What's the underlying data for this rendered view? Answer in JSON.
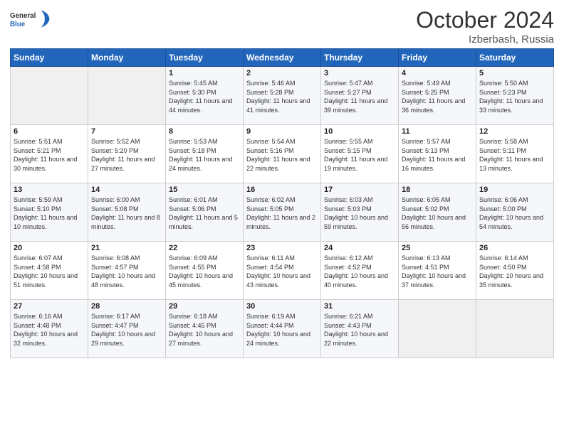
{
  "header": {
    "logo_general": "General",
    "logo_blue": "Blue",
    "title": "October 2024",
    "location": "Izberbash, Russia"
  },
  "weekdays": [
    "Sunday",
    "Monday",
    "Tuesday",
    "Wednesday",
    "Thursday",
    "Friday",
    "Saturday"
  ],
  "weeks": [
    [
      {
        "day": "",
        "empty": true
      },
      {
        "day": "",
        "empty": true
      },
      {
        "day": "1",
        "sunrise": "5:45 AM",
        "sunset": "5:30 PM",
        "daylight": "11 hours and 44 minutes."
      },
      {
        "day": "2",
        "sunrise": "5:46 AM",
        "sunset": "5:28 PM",
        "daylight": "11 hours and 41 minutes."
      },
      {
        "day": "3",
        "sunrise": "5:47 AM",
        "sunset": "5:27 PM",
        "daylight": "11 hours and 39 minutes."
      },
      {
        "day": "4",
        "sunrise": "5:49 AM",
        "sunset": "5:25 PM",
        "daylight": "11 hours and 36 minutes."
      },
      {
        "day": "5",
        "sunrise": "5:50 AM",
        "sunset": "5:23 PM",
        "daylight": "11 hours and 33 minutes."
      }
    ],
    [
      {
        "day": "6",
        "sunrise": "5:51 AM",
        "sunset": "5:21 PM",
        "daylight": "11 hours and 30 minutes."
      },
      {
        "day": "7",
        "sunrise": "5:52 AM",
        "sunset": "5:20 PM",
        "daylight": "11 hours and 27 minutes."
      },
      {
        "day": "8",
        "sunrise": "5:53 AM",
        "sunset": "5:18 PM",
        "daylight": "11 hours and 24 minutes."
      },
      {
        "day": "9",
        "sunrise": "5:54 AM",
        "sunset": "5:16 PM",
        "daylight": "11 hours and 22 minutes."
      },
      {
        "day": "10",
        "sunrise": "5:55 AM",
        "sunset": "5:15 PM",
        "daylight": "11 hours and 19 minutes."
      },
      {
        "day": "11",
        "sunrise": "5:57 AM",
        "sunset": "5:13 PM",
        "daylight": "11 hours and 16 minutes."
      },
      {
        "day": "12",
        "sunrise": "5:58 AM",
        "sunset": "5:11 PM",
        "daylight": "11 hours and 13 minutes."
      }
    ],
    [
      {
        "day": "13",
        "sunrise": "5:59 AM",
        "sunset": "5:10 PM",
        "daylight": "11 hours and 10 minutes."
      },
      {
        "day": "14",
        "sunrise": "6:00 AM",
        "sunset": "5:08 PM",
        "daylight": "11 hours and 8 minutes."
      },
      {
        "day": "15",
        "sunrise": "6:01 AM",
        "sunset": "5:06 PM",
        "daylight": "11 hours and 5 minutes."
      },
      {
        "day": "16",
        "sunrise": "6:02 AM",
        "sunset": "5:05 PM",
        "daylight": "11 hours and 2 minutes."
      },
      {
        "day": "17",
        "sunrise": "6:03 AM",
        "sunset": "5:03 PM",
        "daylight": "10 hours and 59 minutes."
      },
      {
        "day": "18",
        "sunrise": "6:05 AM",
        "sunset": "5:02 PM",
        "daylight": "10 hours and 56 minutes."
      },
      {
        "day": "19",
        "sunrise": "6:06 AM",
        "sunset": "5:00 PM",
        "daylight": "10 hours and 54 minutes."
      }
    ],
    [
      {
        "day": "20",
        "sunrise": "6:07 AM",
        "sunset": "4:58 PM",
        "daylight": "10 hours and 51 minutes."
      },
      {
        "day": "21",
        "sunrise": "6:08 AM",
        "sunset": "4:57 PM",
        "daylight": "10 hours and 48 minutes."
      },
      {
        "day": "22",
        "sunrise": "6:09 AM",
        "sunset": "4:55 PM",
        "daylight": "10 hours and 45 minutes."
      },
      {
        "day": "23",
        "sunrise": "6:11 AM",
        "sunset": "4:54 PM",
        "daylight": "10 hours and 43 minutes."
      },
      {
        "day": "24",
        "sunrise": "6:12 AM",
        "sunset": "4:52 PM",
        "daylight": "10 hours and 40 minutes."
      },
      {
        "day": "25",
        "sunrise": "6:13 AM",
        "sunset": "4:51 PM",
        "daylight": "10 hours and 37 minutes."
      },
      {
        "day": "26",
        "sunrise": "6:14 AM",
        "sunset": "4:50 PM",
        "daylight": "10 hours and 35 minutes."
      }
    ],
    [
      {
        "day": "27",
        "sunrise": "6:16 AM",
        "sunset": "4:48 PM",
        "daylight": "10 hours and 32 minutes."
      },
      {
        "day": "28",
        "sunrise": "6:17 AM",
        "sunset": "4:47 PM",
        "daylight": "10 hours and 29 minutes."
      },
      {
        "day": "29",
        "sunrise": "6:18 AM",
        "sunset": "4:45 PM",
        "daylight": "10 hours and 27 minutes."
      },
      {
        "day": "30",
        "sunrise": "6:19 AM",
        "sunset": "4:44 PM",
        "daylight": "10 hours and 24 minutes."
      },
      {
        "day": "31",
        "sunrise": "6:21 AM",
        "sunset": "4:43 PM",
        "daylight": "10 hours and 22 minutes."
      },
      {
        "day": "",
        "empty": true
      },
      {
        "day": "",
        "empty": true
      }
    ]
  ]
}
